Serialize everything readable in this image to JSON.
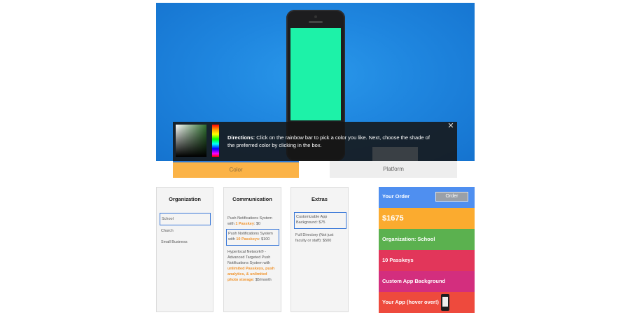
{
  "directions": {
    "label": "Directions:",
    "text": " Click on the rainbow bar to pick a color you like. Next, choose the shade of the preferred color by clicking in the box.",
    "close": "✕"
  },
  "tabs": [
    {
      "label": "Color",
      "active": true
    },
    {
      "label": "Platform",
      "active": false
    }
  ],
  "panels": {
    "organization": {
      "title": "Organization",
      "options": [
        "School",
        "Church",
        "Small Business"
      ]
    },
    "communication": {
      "title": "Communication",
      "opt1": {
        "pre": "Push Notifications System with ",
        "hl": "1 Passkey",
        "post": ": $0"
      },
      "opt2": {
        "pre": "Push Notifications System with ",
        "hl": "10 Passkeys",
        "post": ": $100"
      },
      "opt3": {
        "pre": "Hyperlocal Network® - Advanced Targeted Push Notifications System with ",
        "hl": "unlimited Passkeys, push analytics, & unlimited photo storage",
        "post": ": $5/month"
      }
    },
    "extras": {
      "title": "Extras",
      "options": [
        "Customizable App Background: $75",
        "Full Directory (Not just faculty or staff): $500"
      ]
    }
  },
  "order": {
    "title": "Your Order",
    "button": "Order",
    "price": "$1675",
    "organization": "Organization: School",
    "passkeys": "10 Passkeys",
    "background": "Custom App Background",
    "app": "Your App (hover over!)"
  },
  "colors": {
    "hero_blue": "#1f86df",
    "phone_screen": "#1df2a8",
    "tab_active": "#fbb347",
    "order_head": "#4f8ff0",
    "order_price": "#fbab2f",
    "order_org": "#5bb14f",
    "order_keys": "#e2365a",
    "order_bg": "#d32e7e",
    "order_app": "#ee4a3d"
  }
}
